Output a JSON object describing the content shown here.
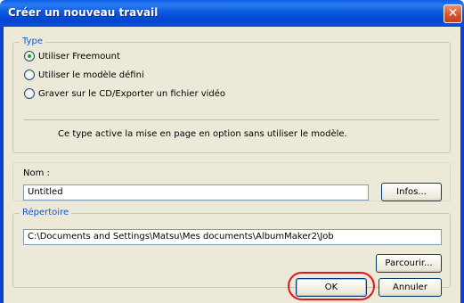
{
  "window": {
    "title": "Créer un nouveau travail",
    "close_glyph": "✕"
  },
  "type_group": {
    "label": "Type",
    "options": [
      {
        "label": "Utiliser Freemount",
        "checked": true
      },
      {
        "label": "Utiliser le modèle défini",
        "checked": false
      },
      {
        "label": "Graver sur le CD/Exporter un fichier vidéo",
        "checked": false
      }
    ],
    "description": "Ce type active la mise en page en option sans utiliser le modèle."
  },
  "name_group": {
    "label": "Nom :",
    "value": "Untitled",
    "info_button": "Infos..."
  },
  "dir_group": {
    "label": "Répertoire",
    "value": "C:\\Documents and Settings\\Matsu\\Mes documents\\AlbumMaker2\\Job",
    "browse_button": "Parcourir..."
  },
  "footer": {
    "ok_label": "OK",
    "cancel_label": "Annuler"
  },
  "colors": {
    "title_bar": "#0a4fd8",
    "group_label": "#1656c8",
    "highlight": "#e01818"
  },
  "icons": {
    "close": "close-icon"
  }
}
